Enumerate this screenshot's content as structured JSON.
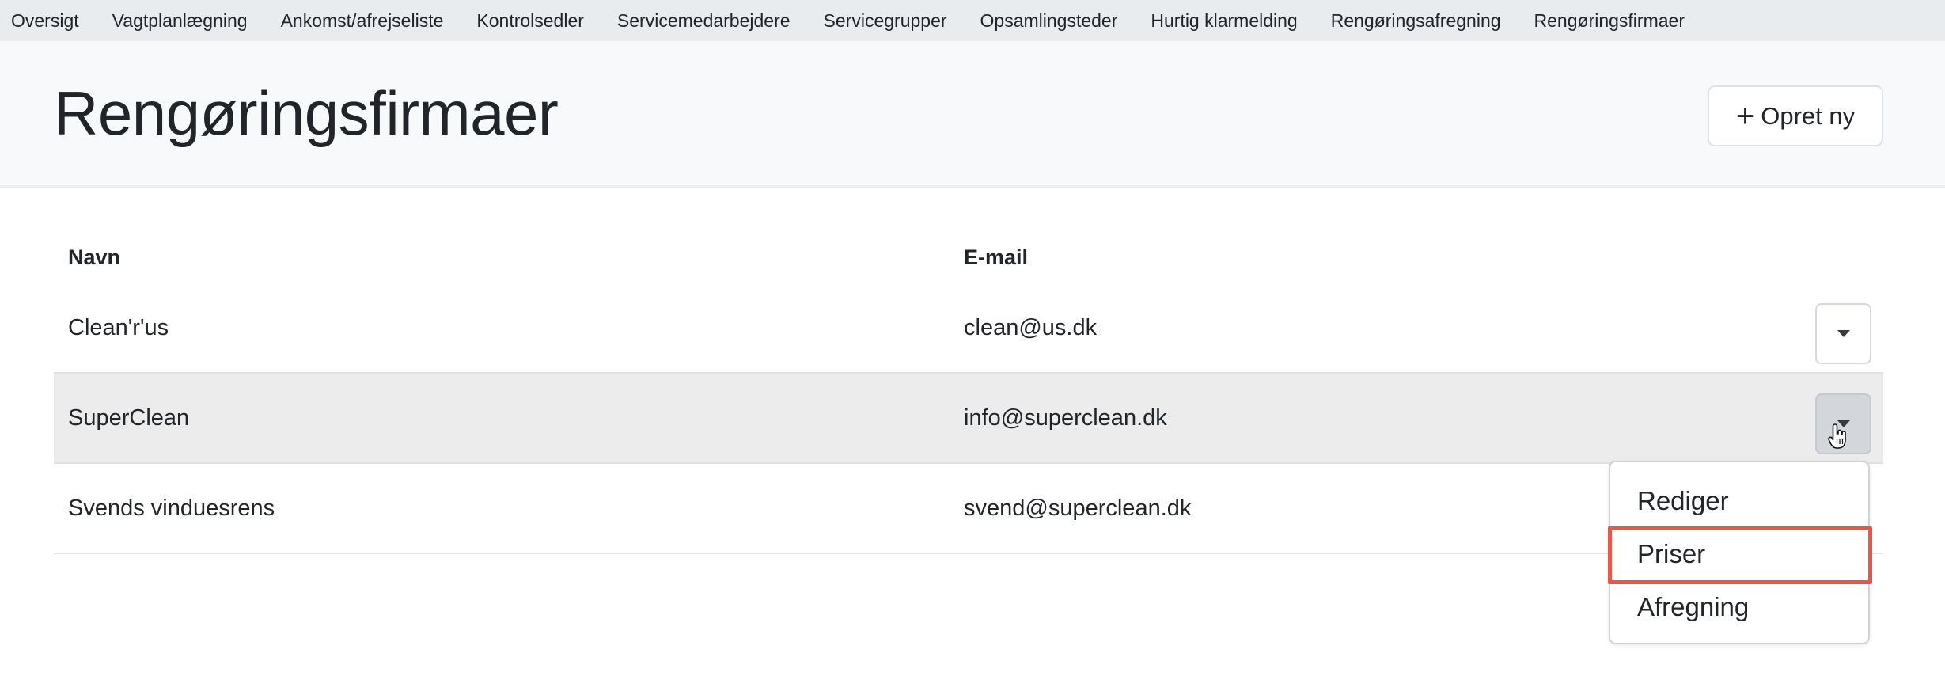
{
  "nav": {
    "items": [
      "Oversigt",
      "Vagtplanlægning",
      "Ankomst/afrejseliste",
      "Kontrolsedler",
      "Servicemedarbejdere",
      "Servicegrupper",
      "Opsamlingsteder",
      "Hurtig klarmelding",
      "Rengøringsafregning",
      "Rengøringsfirmaer"
    ]
  },
  "header": {
    "title": "Rengøringsfirmaer",
    "create_icon": "plus-icon",
    "create_label": "Opret ny"
  },
  "table": {
    "columns": [
      "Navn",
      "E-mail"
    ],
    "rows": [
      {
        "name": "Clean'r'us",
        "email": "clean@us.dk"
      },
      {
        "name": "SuperClean",
        "email": "info@superclean.dk"
      },
      {
        "name": "Svends vinduesrens",
        "email": "svend@superclean.dk"
      }
    ],
    "hovered_row": 1
  },
  "dropdown": {
    "items": [
      "Rediger",
      "Priser",
      "Afregning"
    ],
    "highlighted": "Priser",
    "highlight_color": "#e8574a"
  },
  "colors": {
    "nav_bg": "#e9ecef",
    "header_bg": "#f8f9fa",
    "row_hover_bg": "#ececec"
  }
}
